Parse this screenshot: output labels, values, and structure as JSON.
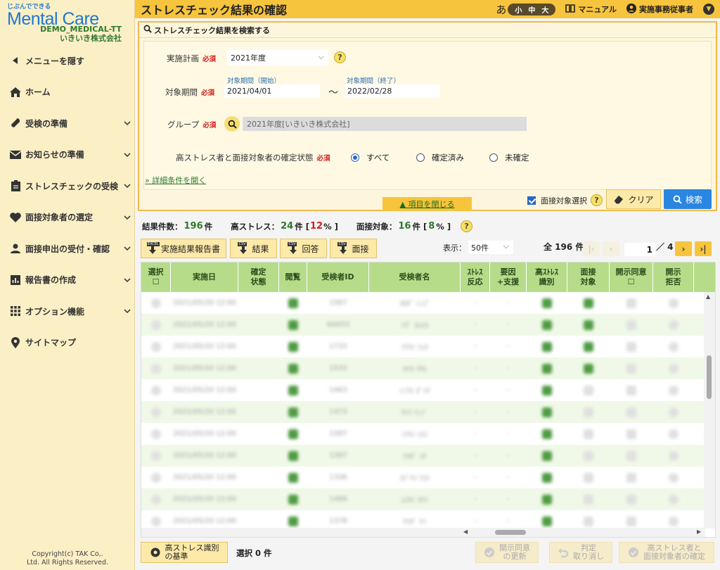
{
  "brand": {
    "small": "じぶんでできる",
    "main": "Mental Care",
    "tenant_id": "DEMO_MEDICAL-TT",
    "company": "いきいき株式会社"
  },
  "sidebar": {
    "items": [
      {
        "label": "メニューを隠す",
        "icon": "triangle-left-icon",
        "chevron": false
      },
      {
        "label": "ホーム",
        "icon": "home-icon",
        "chevron": false
      },
      {
        "label": "受検の準備",
        "icon": "wrench-icon",
        "chevron": true
      },
      {
        "label": "お知らせの準備",
        "icon": "mail-icon",
        "chevron": true
      },
      {
        "label": "ストレスチェックの受検",
        "icon": "clipboard-icon",
        "chevron": true
      },
      {
        "label": "面接対象者の選定",
        "icon": "heart-icon",
        "chevron": true
      },
      {
        "label": "面接申出の受付・確認",
        "icon": "person-icon",
        "chevron": true
      },
      {
        "label": "報告書の作成",
        "icon": "bar-chart-icon",
        "chevron": true
      },
      {
        "label": "オプション機能",
        "icon": "grid-icon",
        "chevron": true
      },
      {
        "label": "サイトマップ",
        "icon": "pin-icon",
        "chevron": false
      }
    ],
    "copyright_1": "Copyright(c) TAK Co,.",
    "copyright_2": "Ltd. All Rights Reserved."
  },
  "header": {
    "title": "ストレスチェック結果の確認",
    "font_glyph": "あ",
    "font_sizes": [
      "小",
      "中",
      "大"
    ],
    "manual": "マニュアル",
    "user": "実施事務従事者"
  },
  "search": {
    "panel_title": "ストレスチェック結果を検索する",
    "required": "必須",
    "plan_label": "実施計画",
    "plan_value": "2021年度",
    "period_label": "対象期間",
    "start_label": "対象期間（開始）",
    "start_value": "2021/04/01",
    "end_label": "対象期間（終了）",
    "end_value": "2022/02/28",
    "tilde": "～",
    "group_label": "グループ",
    "group_value": "2021年度[いきいき株式会社]",
    "status_label": "高ストレス者と面接対象者の確定状態",
    "status_options": [
      "すべて",
      "確定済み",
      "未確定"
    ],
    "detail_link": "» 詳細条件を開く",
    "collapse": "▲ 項目を閉じる",
    "interview_select": "面接対象選択",
    "clear": "クリア",
    "search": "検索"
  },
  "stats": {
    "count_label": "結果件数：",
    "count": "196",
    "unit": "件",
    "high_label": "高ストレス：",
    "high_count": "24",
    "high_pct": "12",
    "interview_label": "面接対象：",
    "interview_count": "16",
    "interview_pct": "8",
    "pct_open": "[",
    "pct_close": "% ]"
  },
  "toolbar": {
    "report": "実施結果報告書",
    "report_tag": "EXCEL",
    "result": "結果",
    "answer": "回答",
    "interview": "面接",
    "csv_tag": "CSV",
    "display_label": "表示：",
    "per_page": "50件",
    "total": "全 196 件",
    "page": "1",
    "pages": "／ 4"
  },
  "table": {
    "headers": [
      {
        "l1": "選択",
        "l2": "☐"
      },
      {
        "l1": "実施日",
        "l2": ""
      },
      {
        "l1": "確定",
        "l2": "状態"
      },
      {
        "l1": "閲覧",
        "l2": ""
      },
      {
        "l1": "受検者ID",
        "l2": ""
      },
      {
        "l1": "受検者名",
        "l2": ""
      },
      {
        "l1": "ｽﾄﾚｽ",
        "l2": "反応"
      },
      {
        "l1": "要因",
        "l2": "+支援"
      },
      {
        "l1": "高ｽﾄﾚｽ",
        "l2": "識別"
      },
      {
        "l1": "面接",
        "l2": "対象"
      },
      {
        "l1": "開示同意",
        "l2": "☐"
      },
      {
        "l1": "開示",
        "l2": "拒否"
      }
    ],
    "rows": [
      {
        "date": "2021/05/20 12:00",
        "id": "1567",
        "name": "ｵｶﾀﾞ ｼﾝｺﾞ",
        "s": "-",
        "f": "-",
        "hs": true,
        "it": true
      },
      {
        "date": "2021/05/20 12:00",
        "id": "6A053",
        "name": "ﾂｸﾞ ﾖｼﾋﾛ",
        "s": "-",
        "f": "-",
        "hs": true,
        "it": true
      },
      {
        "date": "2021/05/20 12:00",
        "id": "1733",
        "name": "ﾏﾂﾓﾄ ﾘｮｳ",
        "s": "-",
        "f": "-",
        "hs": true,
        "it": true
      },
      {
        "date": "2021/05/20 12:00",
        "id": "1533",
        "name": "ﾀﾅｶ ﾏｻﾙ",
        "s": "-",
        "f": "-",
        "hs": true,
        "it": true
      },
      {
        "date": "2021/05/20 12:00",
        "id": "1463",
        "name": "ｲﾉｳｴ ﾀﾞｲｷ",
        "s": "-",
        "f": "-",
        "hs": true,
        "it": false
      },
      {
        "date": "2021/05/20 12:00",
        "id": "1473",
        "name": "ｻﾄｳ ｹﾝｼﾞ",
        "s": "-",
        "f": "-",
        "hs": true,
        "it": false
      },
      {
        "date": "2021/05/20 12:00",
        "id": "1587",
        "name": "ﾐﾔﾓﾄ ﾋﾛﾐ",
        "s": "-",
        "f": "-",
        "hs": true,
        "it": false
      },
      {
        "date": "2021/05/20 12:00",
        "id": "1567",
        "name": "ﾅｶﾀﾞ ﾕｷ",
        "s": "-",
        "f": "-",
        "hs": true,
        "it": false
      },
      {
        "date": "2021/05/20 12:00",
        "id": "1336",
        "name": "ｺﾊﾞﾔｼ ﾏｺﾄ",
        "s": "-",
        "f": "-",
        "hs": true,
        "it": false
      },
      {
        "date": "2021/05/20 12:00",
        "id": "1489",
        "name": "ﾑﾗｶﾐ ﾀｹｼ",
        "s": "-",
        "f": "-",
        "hs": true,
        "it": false
      },
      {
        "date": "2021/05/20 12:00",
        "id": "1378",
        "name": "ﾔﾏﾀﾞ ｹｲ",
        "s": "-",
        "f": "-",
        "hs": true,
        "it": false
      }
    ]
  },
  "bottom": {
    "criteria_l1": "高ストレス識別",
    "criteria_l2": "の基準",
    "selected": "選択 0 件",
    "consent_l1": "開示同意",
    "consent_l2": "の更新",
    "revoke_l1": "判定",
    "revoke_l2": "取り消し",
    "confirm_l1": "高ストレス者と",
    "confirm_l2": "面接対象者の確定"
  }
}
